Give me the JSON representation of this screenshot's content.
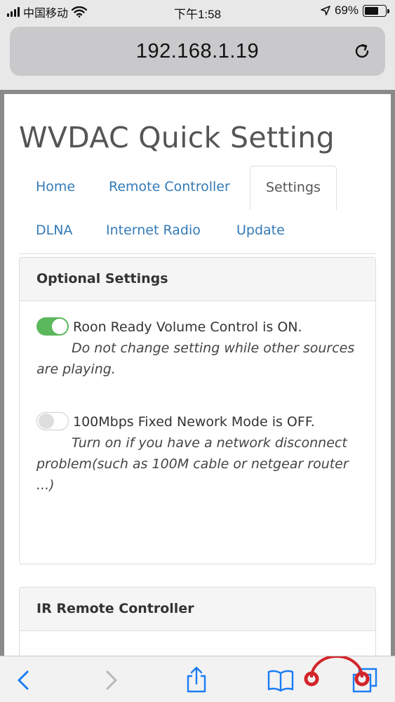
{
  "status_bar": {
    "carrier": "中国移动",
    "time": "下午1:58",
    "battery": "69%",
    "battery_level": 0.69,
    "icons": [
      "signal-icon",
      "wifi-icon",
      "location-arrow-icon",
      "battery-icon"
    ]
  },
  "browser": {
    "url": "192.168.1.19"
  },
  "page": {
    "title": "WVDAC Quick Setting",
    "tabs": [
      {
        "label": "Home",
        "active": false
      },
      {
        "label": "Remote Controller",
        "active": false
      },
      {
        "label": "Settings",
        "active": true
      },
      {
        "label": "DLNA",
        "active": false
      },
      {
        "label": "Internet Radio",
        "active": false
      },
      {
        "label": "Update",
        "active": false
      }
    ],
    "optional_settings": {
      "heading": "Optional Settings",
      "roon": {
        "state": "on",
        "label": "Roon Ready Volume Control is ON.",
        "note": "Do not change setting while other sources are playing."
      },
      "network": {
        "state": "off",
        "label": "100Mbps Fixed Nework Mode is OFF.",
        "note": "Turn on if you have a network disconnect problem(such as 100M cable or netgear router ...)"
      }
    },
    "ir_panel": {
      "heading": "IR Remote Controller"
    }
  },
  "colors": {
    "link": "#337ab7",
    "toggle_on": "#5cb85c",
    "ios_blue": "#1a7cf5"
  }
}
